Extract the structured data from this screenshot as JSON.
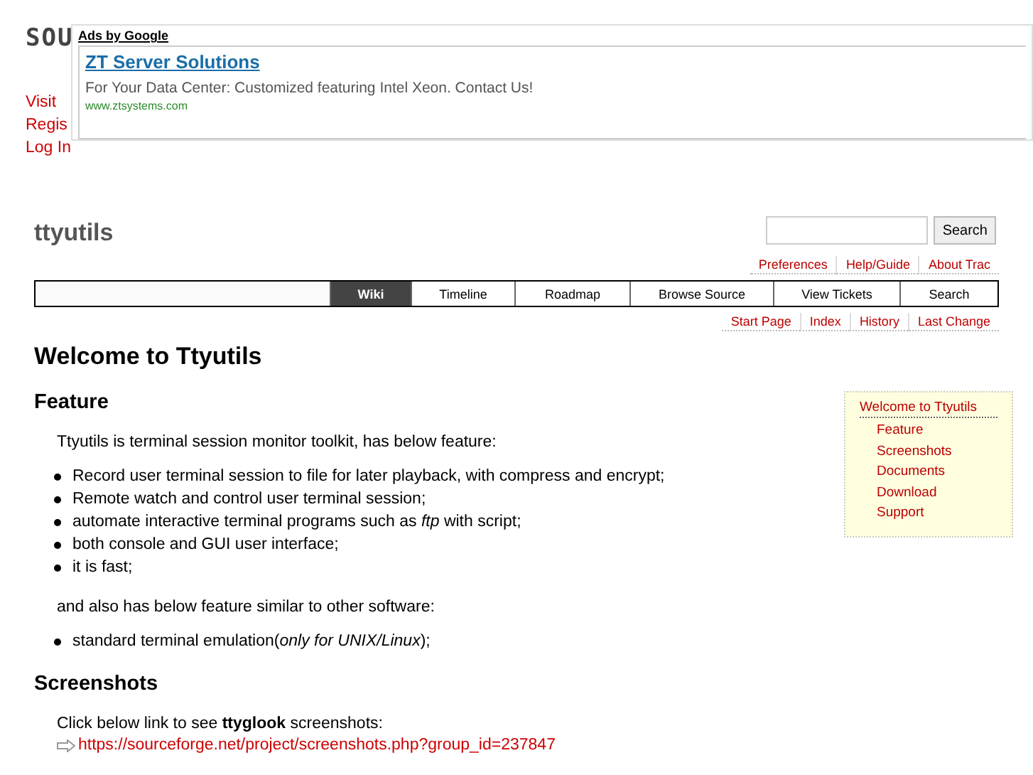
{
  "site_header": {
    "logo": "SOU",
    "links": [
      "Visit",
      "Regis",
      "Log In"
    ]
  },
  "ad": {
    "label": "Ads by Google",
    "title": "ZT Server Solutions",
    "text": "For Your Data Center: Customized featuring Intel Xeon. Contact Us!",
    "url": "www.ztsystems.com"
  },
  "project": {
    "title": "ttyutils"
  },
  "search": {
    "button": "Search"
  },
  "meta_nav": [
    "Preferences",
    "Help/Guide",
    "About Trac"
  ],
  "main_nav": [
    {
      "label": "Wiki",
      "selected": true
    },
    {
      "label": "Timeline",
      "selected": false
    },
    {
      "label": "Roadmap",
      "selected": false
    },
    {
      "label": "Browse Source",
      "selected": false
    },
    {
      "label": "View Tickets",
      "selected": false
    },
    {
      "label": "Search",
      "selected": false
    }
  ],
  "context_nav": [
    "Start Page",
    "Index",
    "History",
    "Last Change"
  ],
  "toc": {
    "title": "Welcome to Ttyutils",
    "children": [
      "Feature",
      "Screenshots",
      "Documents",
      "Download",
      "Support"
    ]
  },
  "page_title": "Welcome to Ttyutils",
  "sections": [
    {
      "heading": "Feature",
      "blocks": [
        {
          "kind": "para",
          "text": "Ttyutils is terminal session monitor toolkit, has below feature:"
        },
        {
          "kind": "list",
          "items": [
            "Record user terminal session to file for later playback, with compress and encrypt;",
            "Remote watch and control user terminal session;",
            "automate interactive terminal programs such as *ftp* with script;",
            "both console and GUI user interface;",
            "it is fast;"
          ]
        },
        {
          "kind": "para",
          "text": "and also has below feature similar to other software:"
        },
        {
          "kind": "list",
          "items": [
            "standard terminal emulation(*only for UNIX/Linux*);"
          ]
        }
      ]
    },
    {
      "heading": "Screenshots",
      "blocks": [
        {
          "kind": "para",
          "text": "Click below link to see **ttyglook** screenshots:"
        },
        {
          "kind": "link",
          "text": "https://sourceforge.net/project/screenshots.php?group_id=237847"
        }
      ]
    }
  ]
}
